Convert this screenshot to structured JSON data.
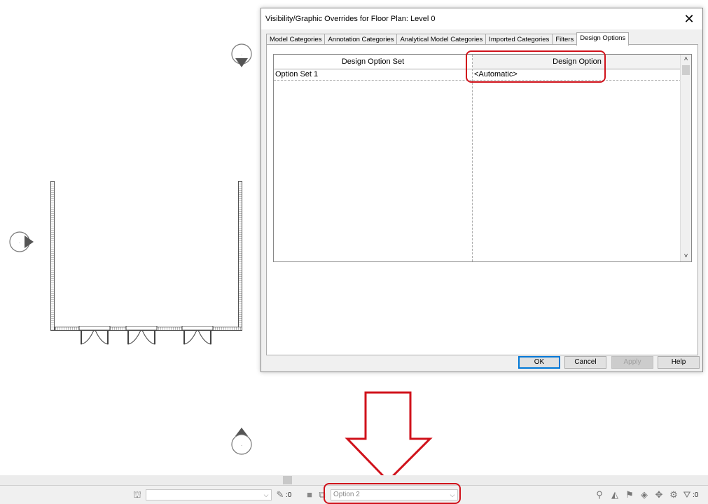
{
  "dialog": {
    "title": "Visibility/Graphic Overrides for Floor Plan: Level 0",
    "close_glyph": "✕",
    "tabs": [
      {
        "label": "Model Categories"
      },
      {
        "label": "Annotation Categories"
      },
      {
        "label": "Analytical Model Categories"
      },
      {
        "label": "Imported Categories"
      },
      {
        "label": "Filters"
      },
      {
        "label": "Design Options"
      }
    ],
    "active_tab": "Design Options",
    "grid": {
      "columns": [
        "Design Option Set",
        "Design Option"
      ],
      "rows": [
        {
          "set": "Option Set 1",
          "option": "<Automatic>"
        }
      ]
    },
    "buttons": {
      "ok": "OK",
      "cancel": "Cancel",
      "apply": "Apply",
      "help": "Help"
    }
  },
  "statusbar": {
    "workset_value": "",
    "count_a": ":0",
    "design_option_value": "Option 2",
    "filter_count": ":0"
  },
  "colors": {
    "highlight": "#d0121b",
    "accent": "#0078d7"
  },
  "icons": [
    "elevation-marker-icon",
    "chevron-down-icon",
    "filter-icon",
    "close-icon"
  ]
}
